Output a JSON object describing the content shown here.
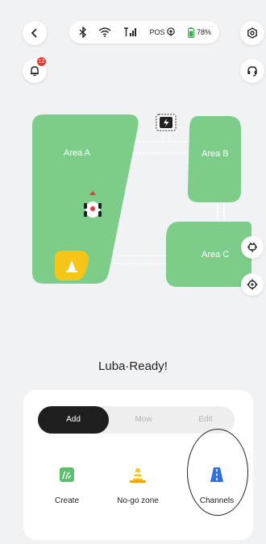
{
  "status_bar": {
    "pos_label": "POS",
    "battery": "78%"
  },
  "notifications": {
    "count": "12"
  },
  "map": {
    "areas": [
      "Area A",
      "Area B",
      "Area C"
    ]
  },
  "robot_status": "Luba·Ready!",
  "tabs": [
    {
      "label": "Add",
      "active": true
    },
    {
      "label": "Mow",
      "active": false
    },
    {
      "label": "Edit",
      "active": false
    }
  ],
  "tools": [
    {
      "label": "Create",
      "icon": "create-area-icon"
    },
    {
      "label": "No-go zone",
      "icon": "traffic-cone-icon"
    },
    {
      "label": "Channels",
      "icon": "road-channel-icon"
    }
  ],
  "colors": {
    "area_green": "#7ccd8a",
    "tab_active": "#1e1e1e",
    "marker_yellow": "#f5c518",
    "channel_blue": "#2f6fe0"
  }
}
